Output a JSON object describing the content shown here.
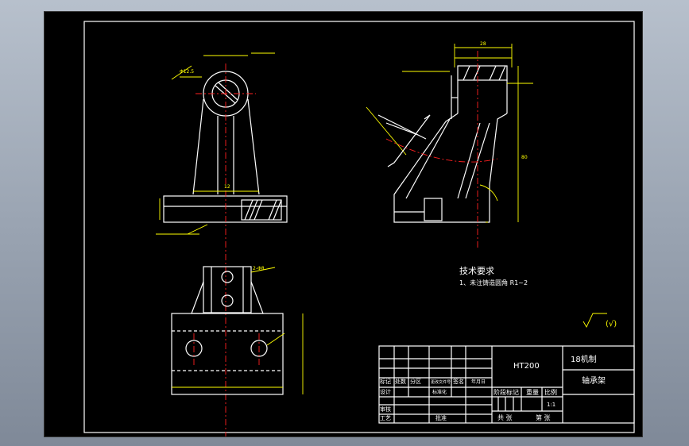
{
  "tech_requirements": {
    "title": "技术要求",
    "item1": "1、未注铸造圆角 R1~2"
  },
  "roughness_note": "(√)",
  "dimensions": {
    "bore": "Φ12.5",
    "hole": "2-Φ8",
    "width_top": "12",
    "width_side": "28",
    "height_side": "80"
  },
  "title_block": {
    "material": "HT200",
    "school": "18机制",
    "part_name": "轴承架",
    "col_mark": "标记",
    "col_count": "处数",
    "col_zone": "分区",
    "col_change_doc": "更改文件号",
    "col_sign": "签名",
    "col_date": "年月日",
    "row_design": "设计",
    "row_std": "标准化",
    "row_review": "审核",
    "row_process": "工艺",
    "row_approve": "批准",
    "stage_mark": "阶段标记",
    "weight": "重量",
    "scale_label": "比例",
    "scale_value": "1:1",
    "sheets_total": "共 张",
    "sheet_no": "第 张"
  }
}
